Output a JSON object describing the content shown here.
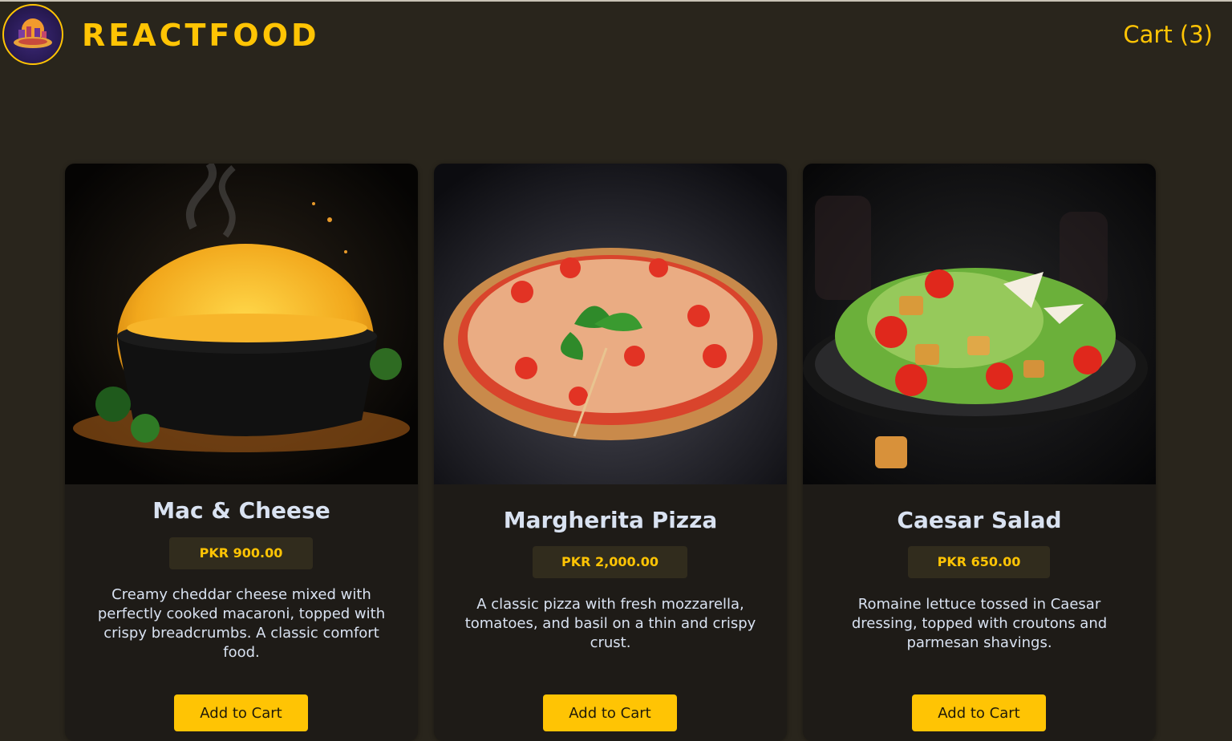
{
  "header": {
    "brand": "REACTFOOD",
    "cart_label": "Cart (3)"
  },
  "meals": [
    {
      "name": "Mac & Cheese",
      "price": "PKR 900.00",
      "description": "Creamy cheddar cheese mixed with perfectly cooked macaroni, topped with crispy breadcrumbs. A classic comfort food.",
      "button": "Add to Cart"
    },
    {
      "name": "Margherita Pizza",
      "price": "PKR 2,000.00",
      "description": "A classic pizza with fresh mozzarella, tomatoes, and basil on a thin and crispy crust.",
      "button": "Add to Cart"
    },
    {
      "name": "Caesar Salad",
      "price": "PKR 650.00",
      "description": "Romaine lettuce tossed in Caesar dressing, topped with croutons and parmesan shavings.",
      "button": "Add to Cart"
    }
  ],
  "colors": {
    "background": "#29251c",
    "accent": "#ffc404",
    "card": "#1e1b17",
    "price_badge": "#312c1d",
    "text": "#d9e2f1"
  }
}
